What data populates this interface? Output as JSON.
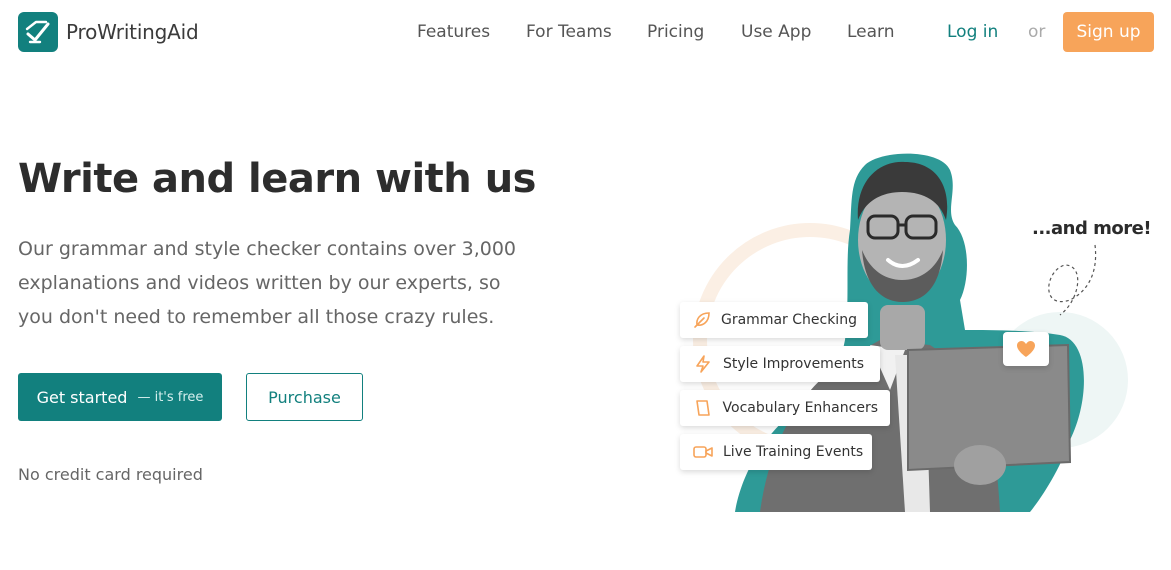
{
  "brand": {
    "name": "ProWritingAid",
    "accent": "#12807e",
    "cta": "#f7a45a"
  },
  "nav": {
    "items": [
      {
        "label": "Features"
      },
      {
        "label": "For Teams"
      },
      {
        "label": "Pricing"
      },
      {
        "label": "Use App"
      },
      {
        "label": "Learn"
      }
    ],
    "login": "Log in",
    "or": "or",
    "signup": "Sign up"
  },
  "hero": {
    "title": "Write and learn with us",
    "description": "Our grammar and style checker contains over 3,000 explanations and videos written by our experts, so you don't need to remember all those crazy rules.",
    "primary_button": {
      "label": "Get started",
      "sub": "— it's free"
    },
    "secondary_button": {
      "label": "Purchase"
    },
    "note": "No credit card required"
  },
  "illustration": {
    "more_text": "...and more!",
    "features": [
      {
        "label": "Grammar Checking",
        "icon": "feather-icon"
      },
      {
        "label": "Style Improvements",
        "icon": "lightning-icon"
      },
      {
        "label": "Vocabulary Enhancers",
        "icon": "book-icon"
      },
      {
        "label": "Live Training Events",
        "icon": "video-icon"
      }
    ],
    "heart_icon": "heart-icon"
  }
}
